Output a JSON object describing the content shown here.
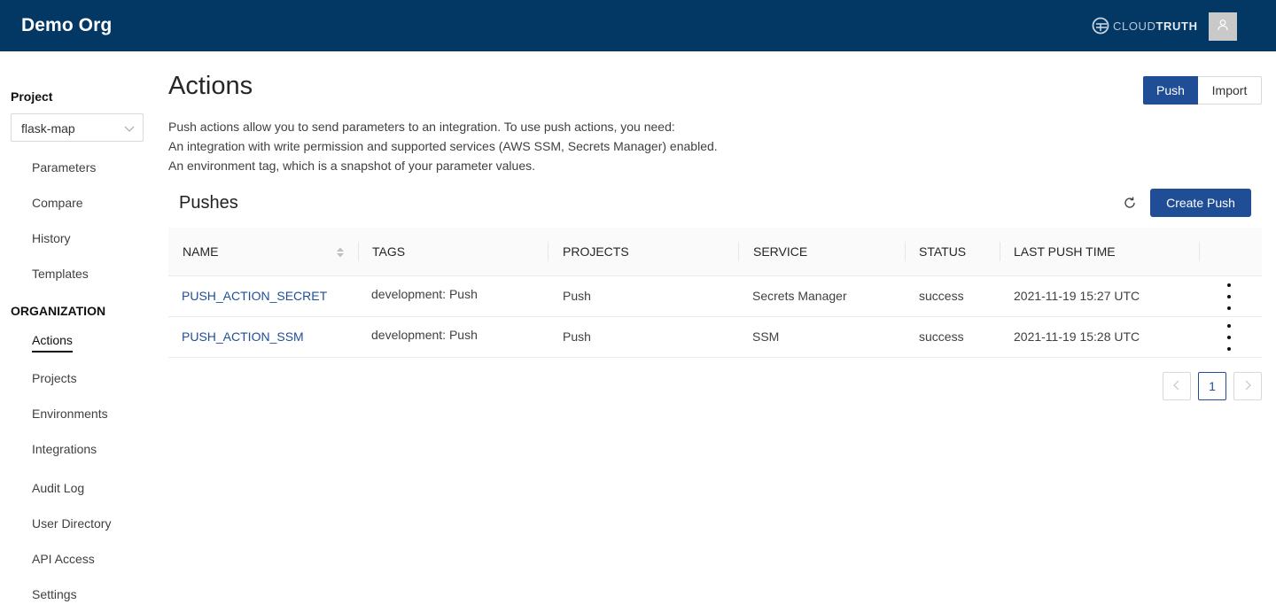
{
  "header": {
    "org_name": "Demo Org",
    "brand": {
      "part1": "CLOUD",
      "part2": "TRUTH",
      "icon": "cloudtruth-logo-icon"
    },
    "avatar_icon": "user-icon"
  },
  "sidebar": {
    "project_label": "Project",
    "project_selected": "flask-map",
    "project_items": [
      "Parameters",
      "Compare",
      "History",
      "Templates"
    ],
    "org_label": "ORGANIZATION",
    "org_items": [
      "Actions",
      "Projects",
      "Environments",
      "Integrations",
      "Audit Log",
      "User Directory",
      "API Access",
      "Settings"
    ],
    "active_item": "Actions"
  },
  "main": {
    "title": "Actions",
    "segments": {
      "push": "Push",
      "import": "Import",
      "selected": "Push"
    },
    "description": [
      "Push actions allow you to send parameters to an integration. To use push actions, you need:",
      "An integration with write permission and supported services (AWS SSM, Secrets Manager) enabled.",
      "An environment tag, which is a snapshot of your parameter values."
    ],
    "section_title": "Pushes",
    "create_button": "Create Push",
    "table": {
      "columns": [
        "NAME",
        "TAGS",
        "PROJECTS",
        "SERVICE",
        "STATUS",
        "LAST PUSH TIME"
      ],
      "rows": [
        [
          "PUSH_ACTION_SECRET",
          "development: Push",
          "Push",
          "Secrets Manager",
          "success",
          "2021-11-19 15:27 UTC"
        ],
        [
          "PUSH_ACTION_SSM",
          "development: Push",
          "Push",
          "SSM",
          "success",
          "2021-11-19 15:28 UTC"
        ]
      ]
    },
    "pagination": {
      "current_page": "1",
      "prev_icon": "chevron-left-icon",
      "next_icon": "chevron-right-icon"
    }
  },
  "colors": {
    "topbar": "#033764",
    "primary": "#1f4e96",
    "link": "#1f4e96"
  }
}
